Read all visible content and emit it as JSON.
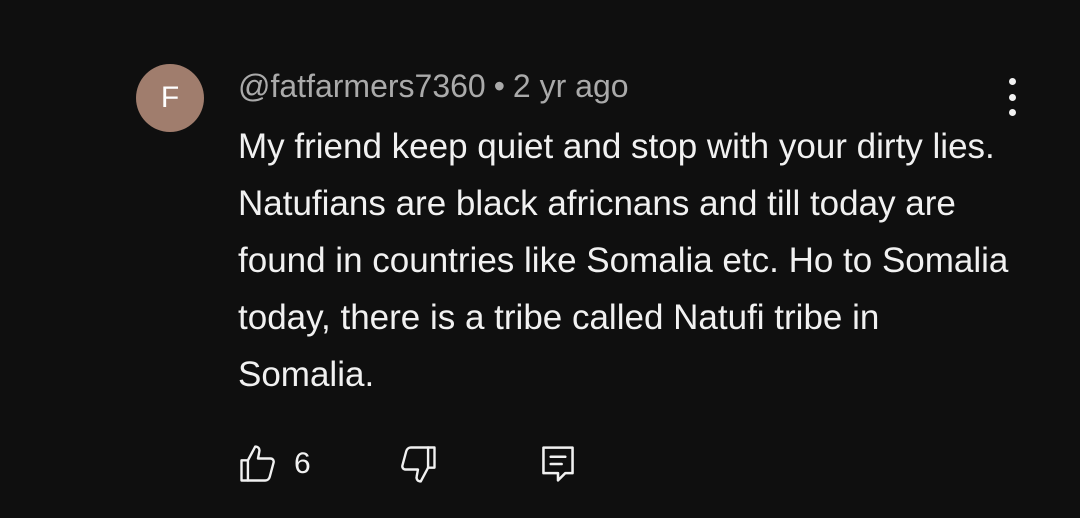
{
  "comment": {
    "avatar_letter": "F",
    "author": "@fatfarmers7360",
    "separator": "•",
    "time": "2 yr ago",
    "text": "My friend keep quiet and stop with your dirty lies. Natufians are black africnans and till today are found in countries like Somalia etc. Ho to Somalia today, there is a tribe called Natufi tribe in Somalia.",
    "like_count": "6"
  },
  "icons": {
    "like": "thumbs-up-icon",
    "dislike": "thumbs-down-icon",
    "reply": "comment-icon",
    "more": "more-vertical-icon"
  },
  "colors": {
    "background": "#0f0f0f",
    "avatar": "#a07d6d",
    "text": "#f1f1f1",
    "meta": "#aaaaaa"
  }
}
